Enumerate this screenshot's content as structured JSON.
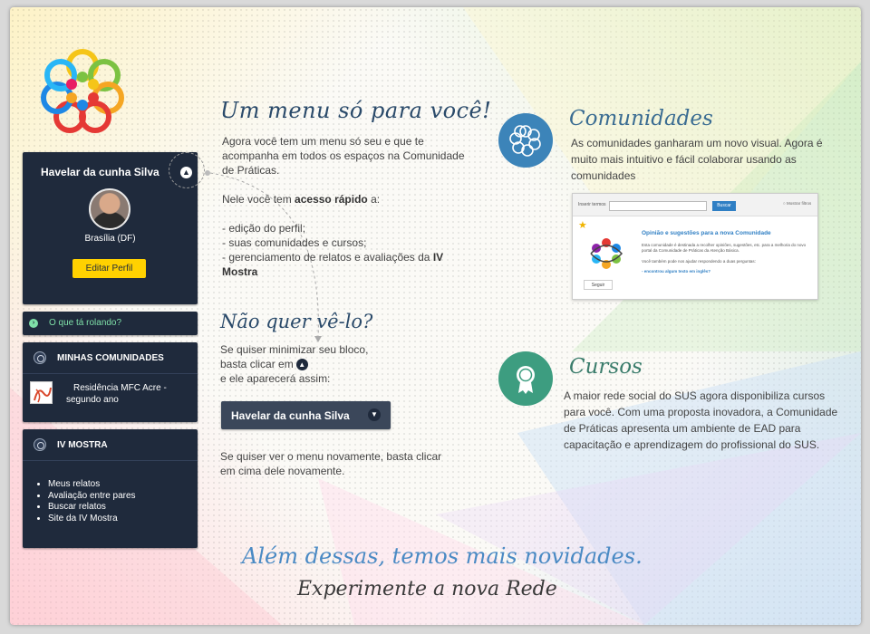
{
  "profile": {
    "name": "Havelar da cunha Silva",
    "city": "Brasília (DF)",
    "edit_label": "Editar Perfil"
  },
  "news": {
    "label": "O que tá rolando?"
  },
  "communities": {
    "title": "MINHAS COMUNIDADES",
    "item_line1": "Residência MFC Acre -",
    "item_line2": "segundo ano"
  },
  "mostra": {
    "title": "IV MOSTRA",
    "items": [
      "Meus relatos",
      "Avaliação entre pares",
      "Buscar relatos",
      "Site da IV Mostra"
    ]
  },
  "menu_section": {
    "heading": "Um menu só para você!",
    "intro": "Agora você tem um menu só seu e que te acompanha em todos os espaços na Comunidade de Práticas.",
    "quick_pre": "Nele você tem",
    "quick_bold": "acesso rápido",
    "quick_post": "a:",
    "list_1": "- edição do perfil;",
    "list_2": "- suas comunidades e cursos;",
    "list_3": "- gerenciamento de relatos e avaliações da",
    "list_3_bold": "IV Mostra"
  },
  "hide_section": {
    "heading": "Não quer vê-lo?",
    "text_1": "Se quiser minimizar seu bloco,",
    "text_2": "basta clicar em",
    "text_3": "e ele aparecerá assim:",
    "bar_label": "Havelar da cunha Silva",
    "text_4": "Se quiser ver o menu novamente, basta clicar em cima dele novamente."
  },
  "communities_section": {
    "heading": "Comunidades",
    "text": "As comunidades ganharam um novo visual. Agora é muito mais intuitivo e fácil colaborar usando as comunidades",
    "shot_label": "Inserir termos",
    "shot_btn": "Buscar",
    "shot_check": "Mostrar filtros",
    "shot_title": "Opinião e sugestões para a nova Comunidade",
    "shot_desc": "Esta comunidade é destinada a recolher opiniões, sugestões, etc. para a melhoria do novo portal da Comunidade de Práticas da Atenção Básica.",
    "shot_desc2": "Você também pode nos ajudar respondendo a duas perguntas:",
    "shot_link": "- encontrou algum texto em inglês?",
    "shot_follow": "Seguir"
  },
  "courses_section": {
    "heading": "Cursos",
    "text": "A maior rede social do SUS agora disponibiliza cursos para você. Com uma proposta inovadora, a Comunidade de Práticas apresenta um ambiente de EAD para capacitação e aprendizagem do profissional do SUS."
  },
  "footer": {
    "line1": "Além dessas, temos mais novidades.",
    "line2": "Experimente a nova Rede"
  },
  "colors": {
    "panel": "#1f2a3c",
    "accent_yellow": "#ffd100",
    "news_green": "#7fe0a8",
    "communities_blue": "#3c84b9",
    "courses_green": "#3d9d80"
  },
  "icons": [
    "logo-rings-icon",
    "chevron-up-icon",
    "chevron-down-icon",
    "community-icon",
    "badge-icon",
    "star-icon"
  ]
}
